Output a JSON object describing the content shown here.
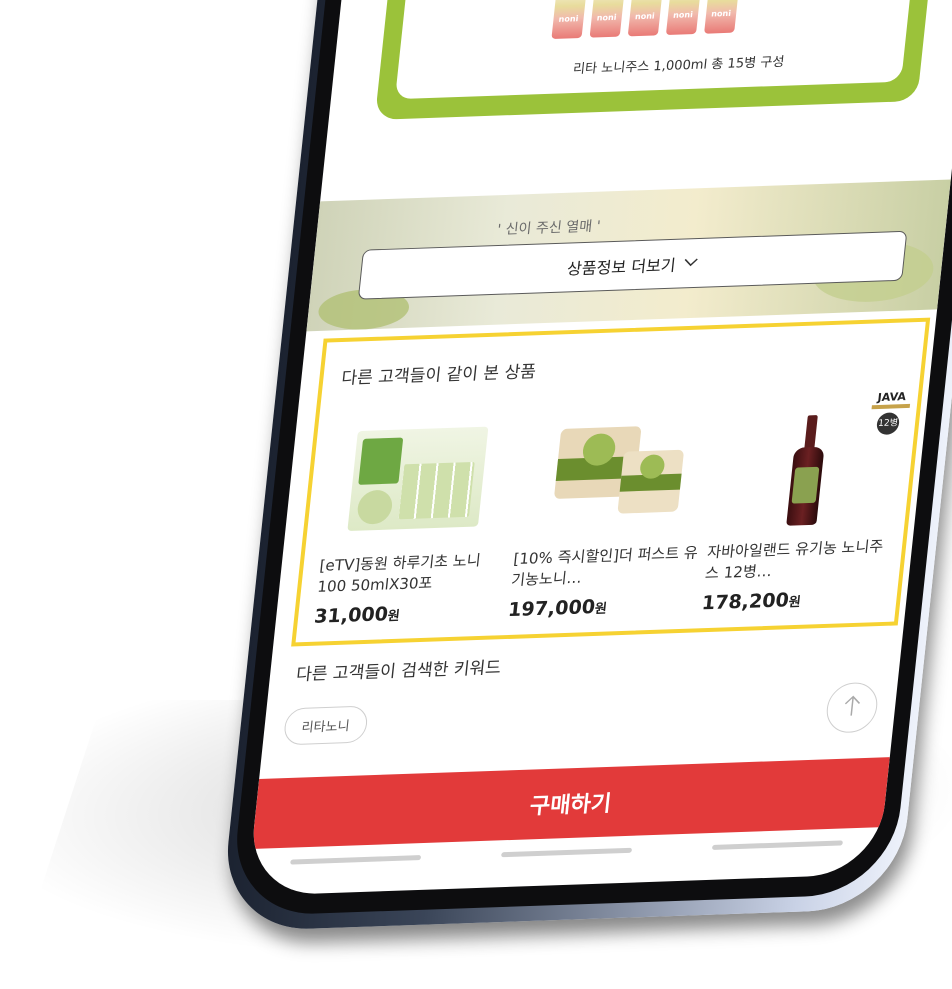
{
  "promo": {
    "bottle_label": "noni",
    "caption": "리타 노니주스 1,000ml 총 15병 구성"
  },
  "banner": {
    "quote": "' 신이 주신 열매 '",
    "more_info_label": "상품정보 더보기",
    "more_info_icon": "chevron-down-icon"
  },
  "related": {
    "title": "다른 고객들이 같이 본 상품",
    "products": [
      {
        "name": "[eTV]동원 하루기초 노니100 50mlX30포",
        "price": "31,000",
        "currency": "원"
      },
      {
        "name": "[10% 즉시할인]더 퍼스트 유기농노니…",
        "price": "197,000",
        "currency": "원"
      },
      {
        "name": "자바아일랜드 유기농 노니주스 12병…",
        "price": "178,200",
        "currency": "원",
        "brand": "JAVA",
        "badge": "12병"
      }
    ]
  },
  "keywords": {
    "title": "다른 고객들이 검색한 키워드",
    "chips": [
      "리타노니"
    ]
  },
  "buy": {
    "label": "구매하기"
  },
  "colors": {
    "accent_red": "#e23a3a",
    "highlight_yellow": "#f6d232",
    "promo_green": "#9bc23a"
  },
  "icons": {
    "scroll_top": "arrow-up-icon"
  }
}
